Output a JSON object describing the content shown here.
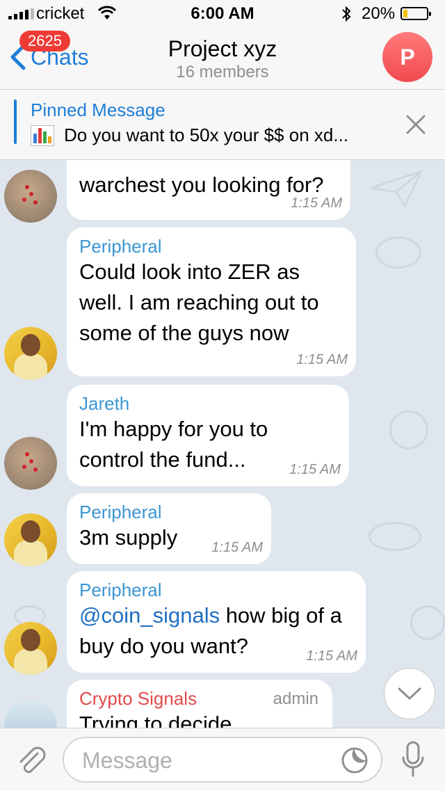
{
  "status_bar": {
    "carrier": "cricket",
    "time": "6:00 AM",
    "battery": "20%",
    "battery_level": 0.2,
    "signal_icon": "signal-bars-icon",
    "wifi_icon": "wifi-icon",
    "bluetooth_icon": "bluetooth-icon"
  },
  "nav": {
    "back_label": "Chats",
    "unread_badge": "2625",
    "title": "Project xyz",
    "subtitle": "16 members",
    "avatar_letter": "P",
    "avatar_color": "#f04b50"
  },
  "pinned": {
    "label": "Pinned Message",
    "icon": "📊",
    "text": "Do you want to 50x your $$ on xd..."
  },
  "messages": [
    {
      "sender": "",
      "text": "warchest you looking for?",
      "time": "1:15 AM",
      "avatar": "map"
    },
    {
      "sender": "Peripheral",
      "text": "Could look into ZER as well. I am reaching out to some of the guys now",
      "time": "1:15 AM",
      "avatar": "man"
    },
    {
      "sender": "Jareth",
      "text": "I'm happy for you to control the fund...",
      "time": "1:15 AM",
      "avatar": "map"
    },
    {
      "sender": "Peripheral",
      "text": "3m supply",
      "time": "1:15 AM",
      "avatar": "man"
    },
    {
      "sender": "Peripheral",
      "mention": "@coin_signals",
      "text": " how big of a buy do you want?",
      "time": "1:15 AM",
      "avatar": "man"
    },
    {
      "sender": "Crypto Signals",
      "role": "admin",
      "text": "Trying to decide",
      "avatar": "sky"
    }
  ],
  "input": {
    "placeholder": "Message"
  },
  "colors": {
    "accent": "#1f7ed8",
    "badge": "#ee3b36",
    "chat_background": "#dfe6ee",
    "sender_name": "#3b95d3",
    "admin_sender_name": "#e24a4a"
  }
}
